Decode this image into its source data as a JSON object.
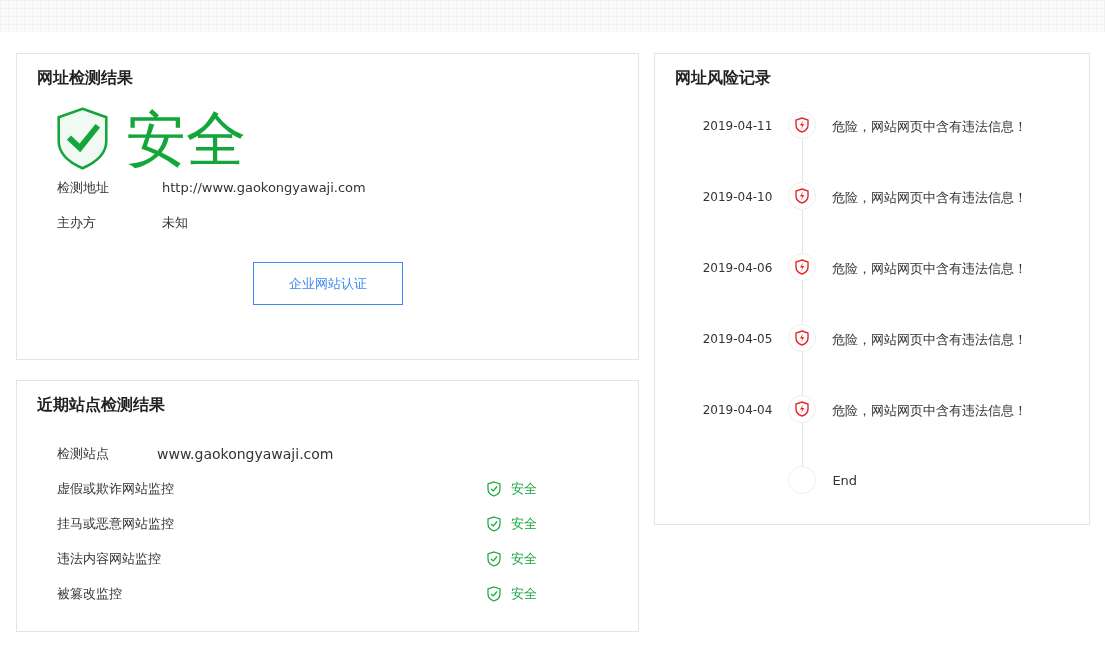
{
  "result_card": {
    "title": "网址检测结果",
    "verdict": {
      "kind": "safe",
      "label": "安全"
    },
    "fields": [
      {
        "label": "检测地址",
        "value": "http://www.gaokongyawaji.com"
      },
      {
        "label": "主办方",
        "value": "未知"
      }
    ],
    "button": "企业网站认证"
  },
  "recent_card": {
    "title": "近期站点检测结果",
    "site_label": "检测站点",
    "site_value": "www.gaokongyawaji.com",
    "checks": [
      {
        "name": "虚假或欺诈网站监控",
        "kind": "safe",
        "status": "安全"
      },
      {
        "name": "挂马或恶意网站监控",
        "kind": "safe",
        "status": "安全"
      },
      {
        "name": "违法内容网站监控",
        "kind": "safe",
        "status": "安全"
      },
      {
        "name": "被篡改监控",
        "kind": "safe",
        "status": "安全"
      }
    ]
  },
  "risk_card": {
    "title": "网址风险记录",
    "timeline": [
      {
        "kind": "danger",
        "date": "2019-04-11",
        "text": "危险，网站网页中含有违法信息！"
      },
      {
        "kind": "danger",
        "date": "2019-04-10",
        "text": "危险，网站网页中含有违法信息！"
      },
      {
        "kind": "danger",
        "date": "2019-04-06",
        "text": "危险，网站网页中含有违法信息！"
      },
      {
        "kind": "danger",
        "date": "2019-04-05",
        "text": "危险，网站网页中含有违法信息！"
      },
      {
        "kind": "danger",
        "date": "2019-04-04",
        "text": "危险，网站网页中含有违法信息！"
      },
      {
        "kind": "end",
        "text": "End"
      }
    ]
  }
}
